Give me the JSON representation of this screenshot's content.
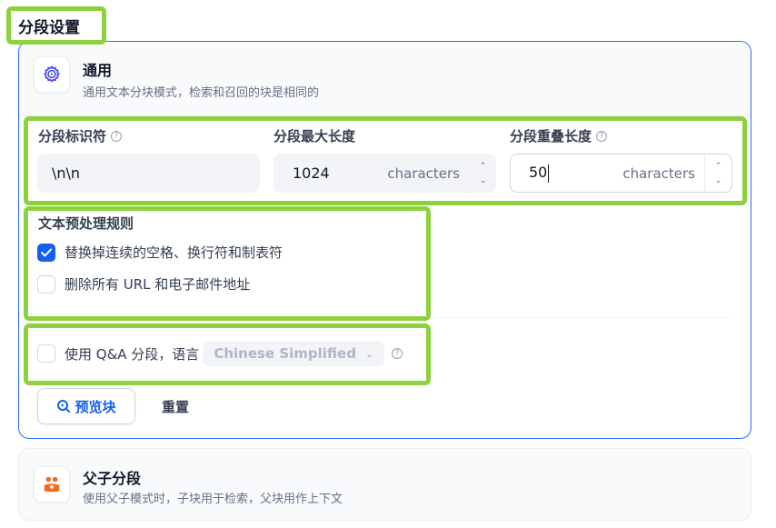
{
  "section_title": "分段设置",
  "general": {
    "title": "通用",
    "description": "通用文本分块模式，检索和召回的块是相同的",
    "separator": {
      "label": "分段标识符",
      "value": "\\n\\n"
    },
    "max_length": {
      "label": "分段最大长度",
      "value": "1024",
      "unit": "characters"
    },
    "overlap": {
      "label": "分段重叠长度",
      "value": "50",
      "unit": "characters"
    },
    "preprocess": {
      "title": "文本预处理规则",
      "rules": [
        {
          "label": "替换掉连续的空格、换行符和制表符",
          "checked": true
        },
        {
          "label": "删除所有 URL 和电子邮件地址",
          "checked": false
        }
      ]
    },
    "qa": {
      "label": "使用 Q&A 分段，语言",
      "checked": false,
      "language": "Chinese Simplified"
    },
    "buttons": {
      "preview": "预览块",
      "reset": "重置"
    }
  },
  "parent_child": {
    "title": "父子分段",
    "description": "使用父子模式时，子块用于检索，父块用作上下文"
  },
  "colors": {
    "accent": "#155eef",
    "highlight": "#8dd13e",
    "parent_child_icon": "#f26b1d"
  }
}
